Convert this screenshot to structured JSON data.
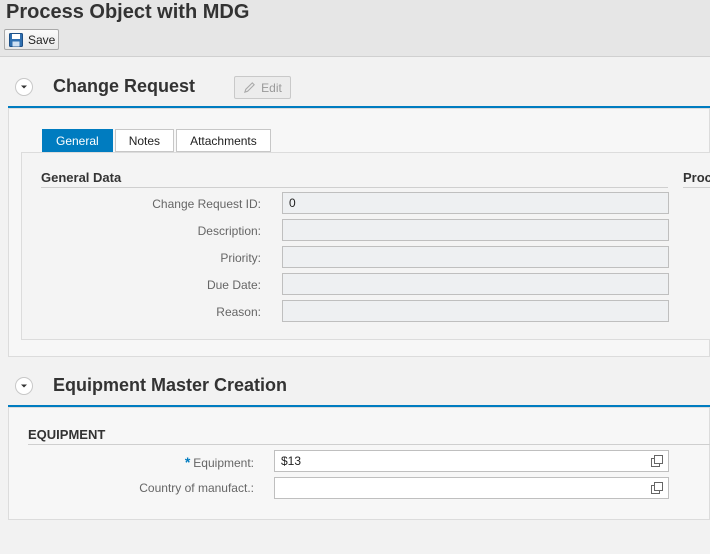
{
  "header": {
    "title": "Process Object with MDG",
    "save_label": "Save"
  },
  "change_request": {
    "title": "Change Request",
    "edit_label": "Edit",
    "tabs": [
      {
        "label": "General",
        "active": true
      },
      {
        "label": "Notes",
        "active": false
      },
      {
        "label": "Attachments",
        "active": false
      }
    ],
    "group_title": "General Data",
    "side_group_title": "Proc",
    "fields": [
      {
        "label": "Change Request ID:",
        "value": "0"
      },
      {
        "label": "Description:",
        "value": ""
      },
      {
        "label": "Priority:",
        "value": ""
      },
      {
        "label": "Due Date:",
        "value": ""
      },
      {
        "label": "Reason:",
        "value": ""
      }
    ]
  },
  "equipment_section": {
    "title": "Equipment Master Creation",
    "group_title": "EQUIPMENT",
    "required_marker": "*",
    "fields": [
      {
        "label": "Equipment:",
        "value": "$13",
        "required": true
      },
      {
        "label": "Country of manufact.:",
        "value": "",
        "required": false
      }
    ]
  },
  "colors": {
    "accent": "#007cc0",
    "background": "#f2f2f2"
  }
}
